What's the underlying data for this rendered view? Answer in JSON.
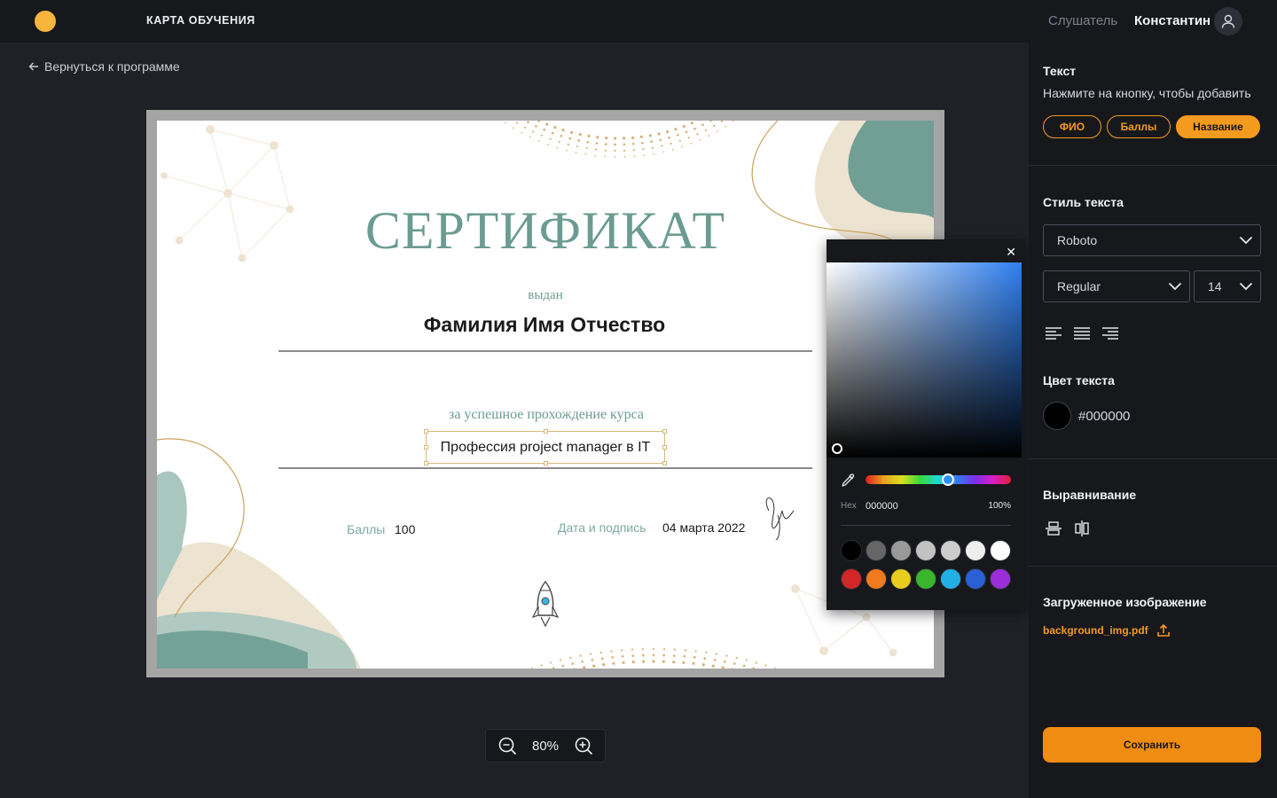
{
  "header": {
    "title": "КАРТА ОБУЧЕНИЯ",
    "role": "Слушатель",
    "user": "Константин"
  },
  "nav": {
    "back": "Вернуться к программе"
  },
  "certificate": {
    "title": "СЕРТИФИКАТ",
    "issued": "выдан",
    "name": "Фамилия Имя Отчество",
    "for_course": "за успешное прохождение курса",
    "course": "Профессия project manager в IT",
    "score_label": "Баллы",
    "score_value": "100",
    "date_label": "Дата и подпись",
    "date_value": "04 марта 2022"
  },
  "zoom": {
    "value": "80%"
  },
  "color_picker": {
    "hex_label": "Hex",
    "hex_value": "000000",
    "opacity": "100%",
    "hue_color": "#2f8ff0",
    "swatches": [
      "#000000",
      "#666666",
      "#999999",
      "#c2c2c2",
      "#cccccc",
      "#eeeeee",
      "#ffffff",
      "#d32626",
      "#f07b1e",
      "#e8cc1e",
      "#3ab52e",
      "#22b0e4",
      "#2a5fd6",
      "#9b2ed8"
    ]
  },
  "sidebar": {
    "text_title": "Текст",
    "text_hint": "Нажмите на кнопку, чтобы добавить",
    "chips": [
      "ФИО",
      "Баллы",
      "Название"
    ],
    "active_chip": "Название",
    "style_title": "Стиль текста",
    "font": "Roboto",
    "weight": "Regular",
    "size": "14",
    "color_title": "Цвет текста",
    "color_value": "#000000",
    "align_title": "Выравнивание",
    "upload_title": "Загруженное изображение",
    "file_name": "background_img.pdf",
    "save": "Сохранить"
  },
  "colors": {
    "accent": "#f39a1f",
    "logo": "#f8b53c",
    "cert_teal": "#6b9b91",
    "cert_beige": "#ede3d1"
  }
}
